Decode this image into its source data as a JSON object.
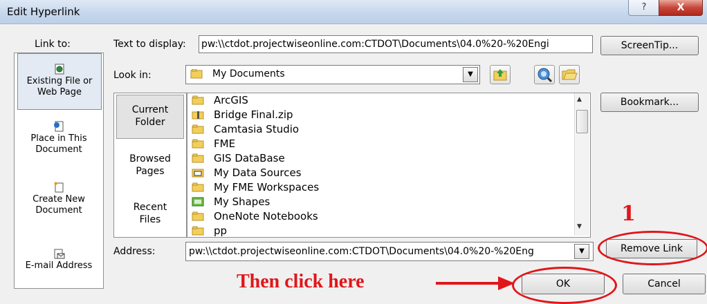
{
  "window": {
    "title": "Edit Hyperlink",
    "help_glyph": "?",
    "close_glyph": "X"
  },
  "link_to": {
    "label": "Link to:",
    "items": [
      {
        "label_line1": "Existing File or",
        "label_line2": "Web Page",
        "icon": "web-file-icon"
      },
      {
        "label_line1": "Place in This",
        "label_line2": "Document",
        "icon": "place-in-document-icon"
      },
      {
        "label_line1": "Create New",
        "label_line2": "Document",
        "icon": "new-document-icon"
      },
      {
        "label_line1": "E-mail Address",
        "label_line2": "",
        "icon": "email-icon"
      }
    ]
  },
  "text_to_display": {
    "label": "Text to display:",
    "value": "pw:\\\\ctdot.projectwiseonline.com:CTDOT\\Documents\\04.0%20-%20Engi"
  },
  "screentip_label": "ScreenTip...",
  "look_in": {
    "label": "Look in:",
    "value": "My Documents"
  },
  "bookmark_label": "Bookmark...",
  "nav": {
    "current": [
      "Current",
      "Folder"
    ],
    "browsed": [
      "Browsed",
      "Pages"
    ],
    "recent": [
      "Recent",
      "Files"
    ]
  },
  "files": [
    {
      "name": "ArcGIS",
      "icon": "folder-icon"
    },
    {
      "name": "Bridge Final.zip",
      "icon": "zip-folder-icon"
    },
    {
      "name": "Camtasia Studio",
      "icon": "folder-icon"
    },
    {
      "name": "FME",
      "icon": "folder-icon"
    },
    {
      "name": "GIS DataBase",
      "icon": "folder-icon"
    },
    {
      "name": "My Data Sources",
      "icon": "data-source-icon"
    },
    {
      "name": "My FME Workspaces",
      "icon": "folder-icon"
    },
    {
      "name": "My Shapes",
      "icon": "shapes-icon"
    },
    {
      "name": "OneNote Notebooks",
      "icon": "folder-icon"
    },
    {
      "name": "pp",
      "icon": "folder-icon"
    }
  ],
  "address": {
    "label": "Address:",
    "value": "pw:\\\\ctdot.projectwiseonline.com:CTDOT\\Documents\\04.0%20-%20Eng"
  },
  "remove_link_label": "Remove Link",
  "ok_label": "OK",
  "cancel_label": "Cancel",
  "annotations": {
    "number": "1",
    "instruction": "Then click here",
    "color": "#e0161a"
  }
}
